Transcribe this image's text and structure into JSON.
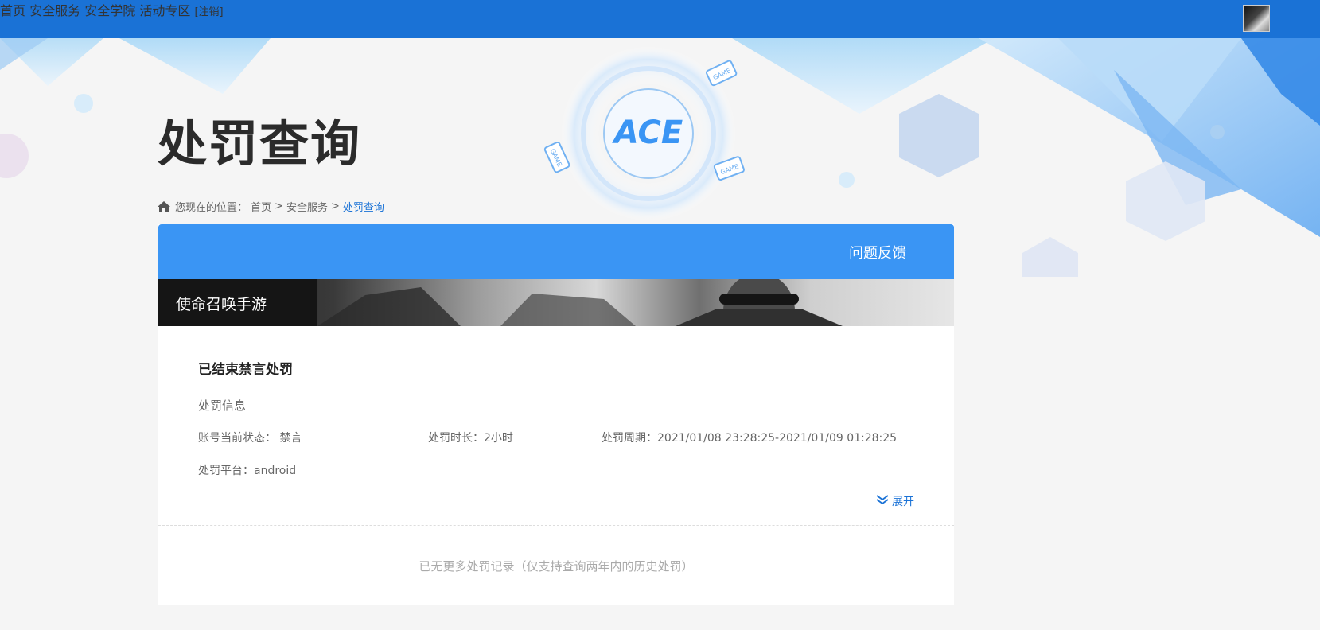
{
  "nav": {
    "items": [
      "首页",
      "安全服务",
      "安全学院",
      "活动专区"
    ],
    "logout": "[注销]"
  },
  "hero": {
    "title": "处罚查询",
    "logo_text": "ACE",
    "badge_text": "GAME"
  },
  "breadcrumb": {
    "prefix": "您现在的位置：",
    "items": [
      "首页",
      "安全服务",
      "处罚查询"
    ],
    "separator": ">"
  },
  "card": {
    "feedback": "问题反馈",
    "game_name": "使命召唤手游",
    "record": {
      "title": "已结束禁言处罚",
      "section": "处罚信息",
      "status": "账号当前状态：  禁言",
      "duration": "处罚时长：2小时",
      "period": "处罚周期：2021/01/08 23:28:25-2021/01/09 01:28:25",
      "platform": "处罚平台：android",
      "expand": "展开"
    },
    "no_more": "已无更多处罚记录（仅支持查询两年内的历史处罚）"
  },
  "colors": {
    "topbar": "#1a72d6",
    "card_header": "#3a95f4",
    "link": "#1a72d6",
    "background": "#f5f5f5"
  }
}
